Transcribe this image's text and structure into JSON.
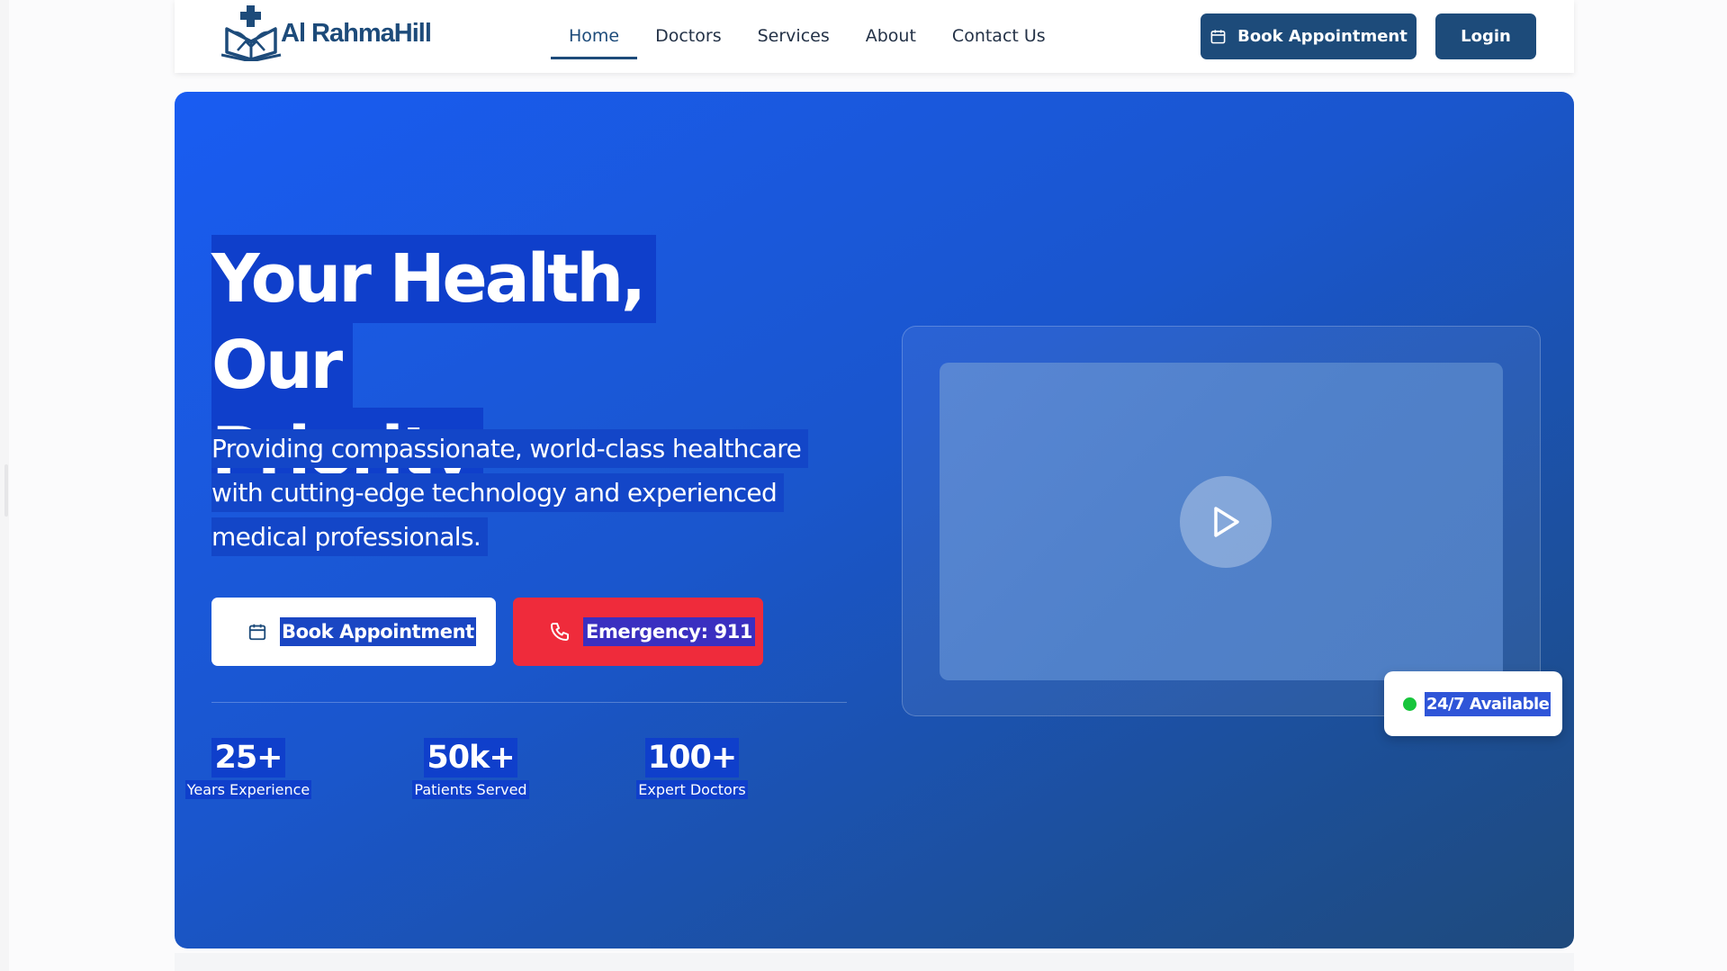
{
  "brand": {
    "name": "Al RahmaHill",
    "logo_icon": "medical-cross-book-icon",
    "color": "#1d4b7a"
  },
  "nav": {
    "items": [
      {
        "label": "Home",
        "active": true
      },
      {
        "label": "Doctors",
        "active": false
      },
      {
        "label": "Services",
        "active": false
      },
      {
        "label": "About",
        "active": false
      },
      {
        "label": "Contact Us",
        "active": false
      }
    ],
    "book_label": "Book Appointment",
    "book_icon": "calendar-icon",
    "login_label": "Login"
  },
  "hero": {
    "title_line1": "Your Health, Our",
    "title_line2": "Priority",
    "subtitle_lines": [
      "Providing compassionate, world-class healthcare",
      "with cutting-edge technology and experienced",
      "medical professionals."
    ],
    "primary_cta": {
      "label": "Book Appointment",
      "icon": "calendar-icon"
    },
    "emergency_cta": {
      "label": "Emergency: 911",
      "icon": "phone-icon",
      "color": "#ef2b3b"
    },
    "stats": [
      {
        "value": "25+",
        "label": "Years Experience"
      },
      {
        "value": "50k+",
        "label": "Patients Served"
      },
      {
        "value": "100+",
        "label": "Expert Doctors"
      }
    ],
    "video": {
      "play_icon": "play-icon"
    },
    "availability_badge": {
      "text": "24/7 Available",
      "status_color": "#17c53b"
    }
  },
  "colors": {
    "primary": "#1d4b7a",
    "hero_gradient_start": "#195cf2",
    "hero_gradient_end": "#1f4a7c"
  }
}
